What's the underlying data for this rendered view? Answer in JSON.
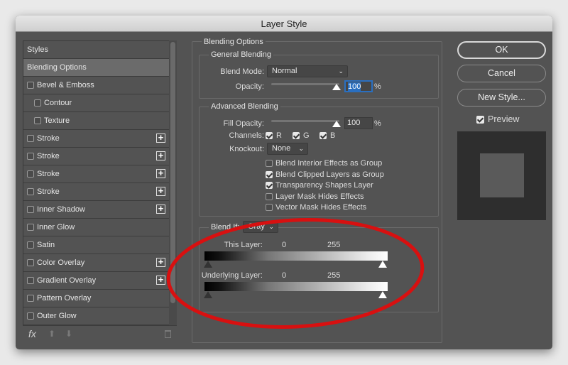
{
  "window": {
    "title": "Layer Style"
  },
  "sidebar": {
    "items": [
      {
        "label": "Styles",
        "checkbox": false,
        "plus": false,
        "indent": 0
      },
      {
        "label": "Blending Options",
        "checkbox": false,
        "plus": false,
        "indent": 0,
        "selected": true
      },
      {
        "label": "Bevel & Emboss",
        "checkbox": true,
        "checked": false,
        "plus": false,
        "indent": 0
      },
      {
        "label": "Contour",
        "checkbox": true,
        "checked": false,
        "plus": false,
        "indent": 1
      },
      {
        "label": "Texture",
        "checkbox": true,
        "checked": false,
        "plus": false,
        "indent": 1
      },
      {
        "label": "Stroke",
        "checkbox": true,
        "checked": false,
        "plus": true,
        "indent": 0
      },
      {
        "label": "Stroke",
        "checkbox": true,
        "checked": false,
        "plus": true,
        "indent": 0
      },
      {
        "label": "Stroke",
        "checkbox": true,
        "checked": false,
        "plus": true,
        "indent": 0
      },
      {
        "label": "Stroke",
        "checkbox": true,
        "checked": false,
        "plus": true,
        "indent": 0
      },
      {
        "label": "Inner Shadow",
        "checkbox": true,
        "checked": false,
        "plus": true,
        "indent": 0
      },
      {
        "label": "Inner Glow",
        "checkbox": true,
        "checked": false,
        "plus": false,
        "indent": 0
      },
      {
        "label": "Satin",
        "checkbox": true,
        "checked": false,
        "plus": false,
        "indent": 0
      },
      {
        "label": "Color Overlay",
        "checkbox": true,
        "checked": false,
        "plus": true,
        "indent": 0
      },
      {
        "label": "Gradient Overlay",
        "checkbox": true,
        "checked": false,
        "plus": true,
        "indent": 0
      },
      {
        "label": "Pattern Overlay",
        "checkbox": true,
        "checked": false,
        "plus": false,
        "indent": 0
      },
      {
        "label": "Outer Glow",
        "checkbox": true,
        "checked": false,
        "plus": false,
        "indent": 0
      }
    ],
    "footer": {
      "fx_label": "fx",
      "icons": [
        "fx-icon",
        "move-up-icon",
        "move-down-icon",
        "trash-icon"
      ]
    }
  },
  "blending": {
    "title": "Blending Options",
    "general": {
      "title": "General Blending",
      "blend_mode_label": "Blend Mode:",
      "blend_mode": "Normal",
      "opacity_label": "Opacity:",
      "opacity": "100",
      "opacity_unit": "%",
      "opacity_percent": 100
    },
    "advanced": {
      "title": "Advanced Blending",
      "fill_label": "Fill Opacity:",
      "fill": "100",
      "fill_unit": "%",
      "fill_percent": 100,
      "channels_label": "Channels:",
      "channels": [
        {
          "label": "R",
          "checked": true
        },
        {
          "label": "G",
          "checked": true
        },
        {
          "label": "B",
          "checked": true
        }
      ],
      "knockout_label": "Knockout:",
      "knockout": "None",
      "options": [
        {
          "label": "Blend Interior Effects as Group",
          "checked": false
        },
        {
          "label": "Blend Clipped Layers as Group",
          "checked": true
        },
        {
          "label": "Transparency Shapes Layer",
          "checked": true
        },
        {
          "label": "Layer Mask Hides Effects",
          "checked": false
        },
        {
          "label": "Vector Mask Hides Effects",
          "checked": false
        }
      ]
    },
    "blend_if": {
      "label": "Blend If:",
      "channel": "Gray",
      "this_layer": {
        "label": "This Layer:",
        "min": "0",
        "max": "255"
      },
      "underlying": {
        "label": "Underlying Layer:",
        "min": "0",
        "max": "255"
      }
    }
  },
  "buttons": {
    "ok": "OK",
    "cancel": "Cancel",
    "new_style": "New Style..."
  },
  "preview": {
    "label": "Preview",
    "checked": true
  },
  "annotation": {
    "color": "#d81010",
    "shape": "ellipse"
  }
}
